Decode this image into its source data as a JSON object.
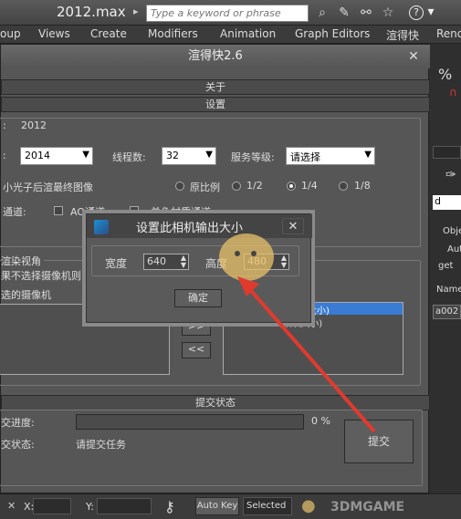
{
  "titlebar": {
    "app_title": "2012.max",
    "search_placeholder": "Type a keyword or phrase",
    "help": "?"
  },
  "menubar": [
    "oup",
    "Views",
    "Create",
    "Modifiers",
    "Animation",
    "Graph Editors",
    "渲得快",
    "Rend"
  ],
  "dialog": {
    "title": "渲得快2.6",
    "close": "✕",
    "about_bar": "关于",
    "settings_bar": "设置",
    "version_value": "2012",
    "version_label": ":",
    "max_version_combo": "2014",
    "threads_label": "线程数:",
    "threads_combo": "32",
    "service_level_label": "服务等级:",
    "service_level_combo": "请选择",
    "render_option": "小光子后渲最终图像",
    "ratio_label_orig": "原比例",
    "ratio_half": "1/2",
    "ratio_quarter": "1/4",
    "ratio_eighth": "1/8",
    "channel_label": "通道:",
    "ao_label": "AO通道",
    "mono_material_label": "单色材质通道",
    "camera_group_label": "渲染视角",
    "camera_hint_1": "果不选择摄像机则",
    "camera_hint_2": "选的摄像机",
    "right_list_items": [
      "大小)",
      "Camera001(默认大小)"
    ],
    "add_btn": ">>",
    "remove_btn": "<<",
    "submit_bar": "提交状态",
    "progress_label": "交进度:",
    "progress_value": "0 %",
    "state_label": "交状态:",
    "state_value": "请提交任务",
    "submit_btn": "提交"
  },
  "subdialog": {
    "title": "设置此相机输出大小",
    "close": "✕",
    "width_label": "宽度",
    "width_value": "640",
    "height_label": "高度",
    "height_value": "480",
    "ok_btn": "确定"
  },
  "rightpanel": {
    "pct": "%",
    "d": "d",
    "obj": "Obje",
    "aut": "Aut",
    "get": "get",
    "name": "Name",
    "a002": "a002"
  },
  "status": {
    "x_label": "X:",
    "y_label": "Y:",
    "auto_key": "Auto Key",
    "selected": "Selected"
  },
  "watermark": {
    "text": "3DMGAME"
  },
  "colors": {
    "highlight": "#3a7bd5",
    "arrow": "#e03a2f"
  }
}
